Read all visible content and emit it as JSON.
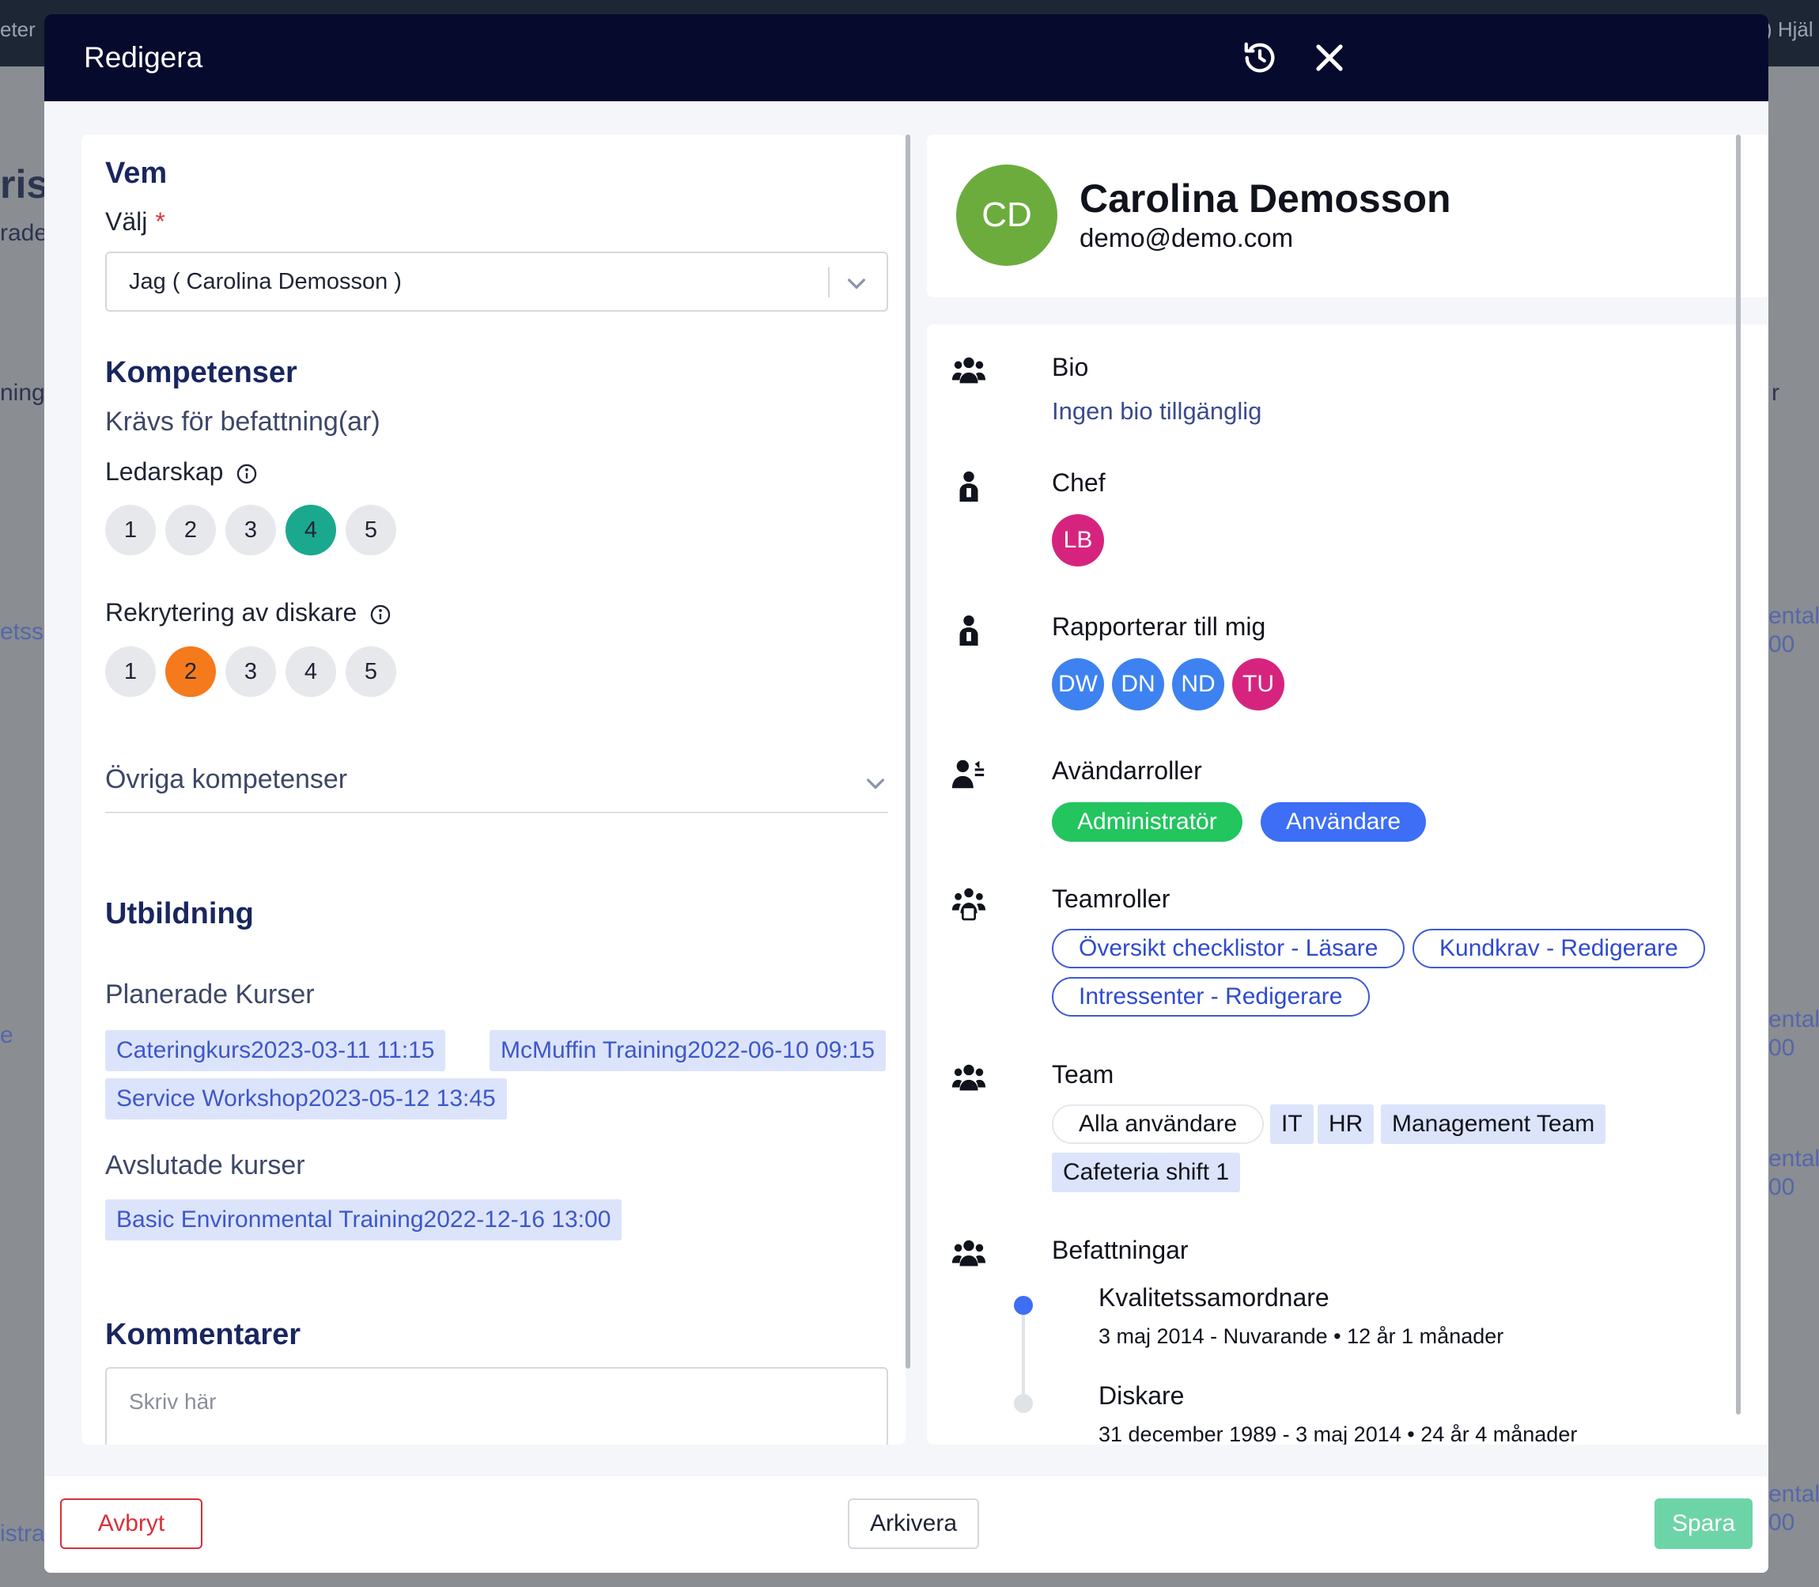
{
  "background": {
    "top_left": "eter",
    "top_right": ") Hjäl",
    "left_fragments": [
      "ris",
      "rade",
      "ning",
      "etssa",
      "e",
      "istra"
    ],
    "right_fragments": [
      "r",
      "ental",
      "00",
      "ental",
      "00",
      "ental",
      "00",
      "ental",
      "00"
    ]
  },
  "modal": {
    "title": "Redigera",
    "history_icon": "history-icon",
    "close_icon": "close-icon"
  },
  "left": {
    "who": {
      "title": "Vem",
      "select_label": "Välj",
      "required_mark": "*",
      "select_value": "Jag ( Carolina Demosson )"
    },
    "competences": {
      "title": "Kompetenser",
      "subtitle": "Krävs för befattning(ar)",
      "skills": [
        {
          "name": "Ledarskap",
          "levels": [
            "1",
            "2",
            "3",
            "4",
            "5"
          ],
          "selected": 4,
          "color": "#1aa98f"
        },
        {
          "name": "Rekrytering av diskare",
          "levels": [
            "1",
            "2",
            "3",
            "4",
            "5"
          ],
          "selected": 2,
          "color": "#f57a1c"
        }
      ],
      "other_label": "Övriga kompetenser"
    },
    "education": {
      "title": "Utbildning",
      "planned_label": "Planerade Kurser",
      "planned": [
        "Cateringkurs2023-03-11 11:15",
        "McMuffin Training2022-06-10 09:15",
        "Service Workshop2023-05-12 13:45"
      ],
      "completed_label": "Avslutade kurser",
      "completed": [
        "Basic Environmental Training2022-12-16 13:00"
      ]
    },
    "comments": {
      "title": "Kommentarer",
      "placeholder": "Skriv här"
    }
  },
  "profile": {
    "initials": "CD",
    "name": "Carolina Demosson",
    "email": "demo@demo.com",
    "avatar_color": "#6cac3d"
  },
  "details": {
    "bio": {
      "label": "Bio",
      "text": "Ingen bio tillgänglig"
    },
    "manager": {
      "label": "Chef",
      "avatar": {
        "initials": "LB",
        "color": "#d6247e"
      }
    },
    "reports": {
      "label": "Rapporterar till mig",
      "avatars": [
        {
          "initials": "DW",
          "color": "#3d82f0"
        },
        {
          "initials": "DN",
          "color": "#3d82f0"
        },
        {
          "initials": "ND",
          "color": "#3d82f0"
        },
        {
          "initials": "TU",
          "color": "#d6247e"
        }
      ]
    },
    "user_roles": {
      "label": "Avändarroller",
      "roles": [
        "Administratör",
        "Användare"
      ]
    },
    "team_roles": {
      "label": "Teamroller",
      "roles": [
        "Översikt checklistor - Läsare",
        "Kundkrav - Redigerare",
        "Intressenter - Redigerare"
      ]
    },
    "teams": {
      "label": "Team",
      "items": [
        "Alla användare",
        "IT",
        "HR",
        "Management Team",
        "Cafeteria shift 1"
      ]
    },
    "positions": {
      "label": "Befattningar",
      "items": [
        {
          "title": "Kvalitetssamordnare",
          "meta": "3 maj 2014 - Nuvarande • 12 år 1 månader",
          "current": true
        },
        {
          "title": "Diskare",
          "meta": "31 december 1989 - 3 maj 2014 • 24 år 4 månader",
          "current": false
        }
      ]
    }
  },
  "footer": {
    "cancel": "Avbryt",
    "archive": "Arkivera",
    "save": "Spara"
  },
  "colors": {
    "header_bg": "#060b2e",
    "section_title": "#19265f",
    "danger": "#d8313a",
    "save": "#6dd4a7",
    "chip_bg": "#dce4fb"
  }
}
